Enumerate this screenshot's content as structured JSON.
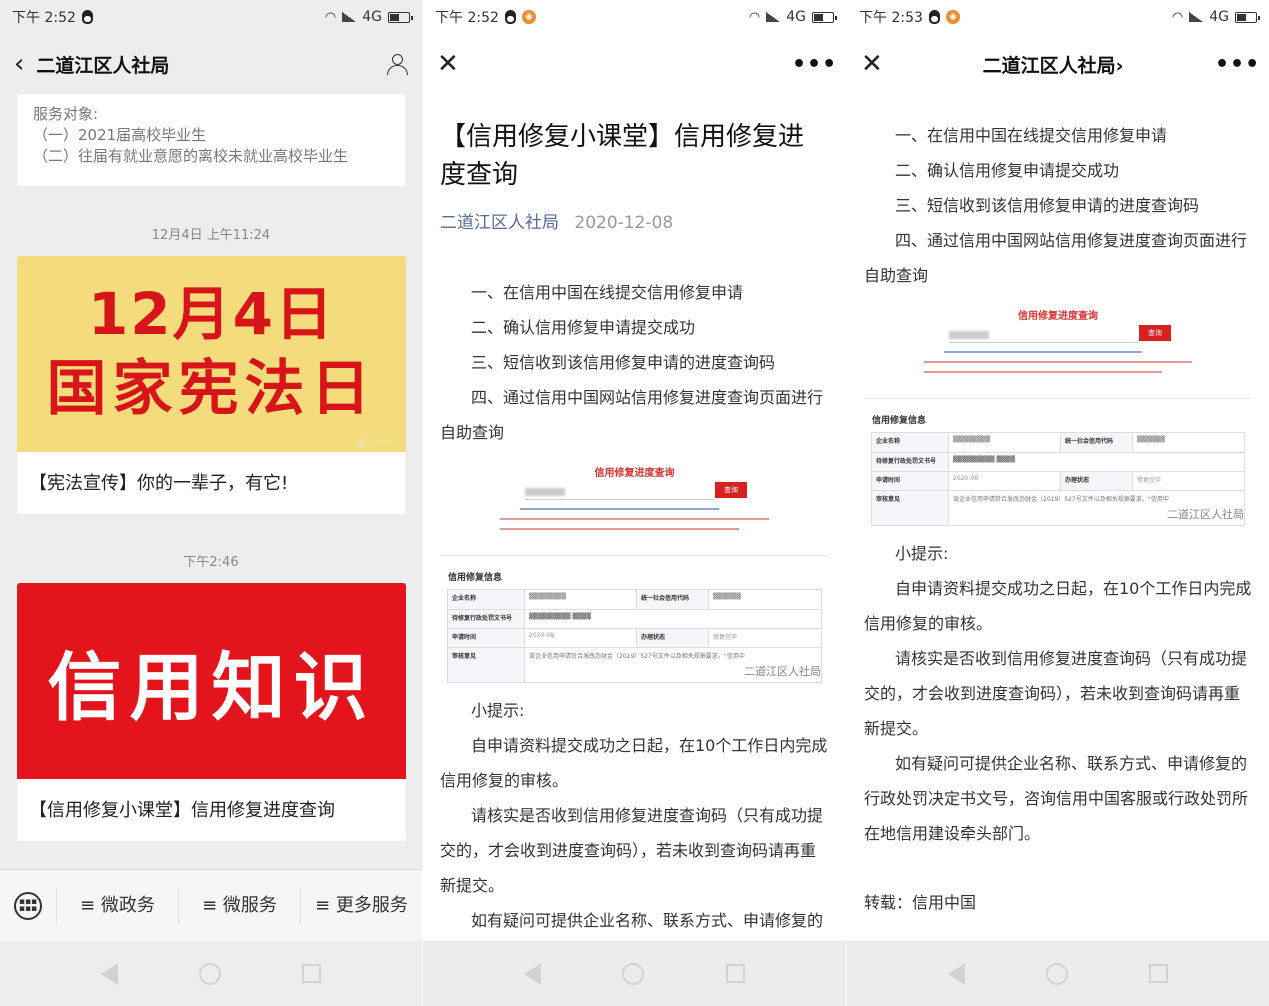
{
  "phone1": {
    "status": {
      "time": "下午 2:52",
      "net": "4G"
    },
    "nav": {
      "title": "二道江区人社局"
    },
    "service": {
      "lines": [
        "服务对象:",
        "（一）2021届高校毕业生",
        "（二）往届有就业意愿的离校未就业高校毕业生"
      ]
    },
    "messages": [
      {
        "time": "12月4日 上午11:24",
        "banner_line1": "12月4日",
        "banner_line2": "国家宪法日",
        "caption": "【宪法宣传】你的一辈子，有它!"
      },
      {
        "time": "下午2:46",
        "banner_line1": "信用知识",
        "caption": "【信用修复小课堂】信用修复进度查询"
      }
    ],
    "menu": [
      {
        "label": "≡ 微政务"
      },
      {
        "label": "≡ 微服务"
      },
      {
        "label": "≡ 更多服务"
      }
    ]
  },
  "phone2": {
    "status": {
      "time": "下午 2:52",
      "net": "4G"
    },
    "article": {
      "title": "【信用修复小课堂】信用修复进度查询",
      "account": "二道江区人社局",
      "date": "2020-12-08",
      "steps": [
        "一、在信用中国在线提交信用修复申请",
        "二、确认信用修复申请提交成功",
        "三、短信收到该信用修复申请的进度查询码",
        "四、通过信用中国网站信用修复进度查询页面进行自助查询"
      ],
      "image": {
        "search_title": "信用修复进度查询",
        "search_btn": "查询",
        "table_caption": "信用修复信息",
        "rows": [
          {
            "k1": "企业名称",
            "k2": "统一社会信用代码"
          },
          {
            "k1": "待修复行政处罚文书号"
          },
          {
            "k1": "申请时间",
            "v1": "2020-08",
            "k2": "办理状态",
            "v2": "修复完毕"
          },
          {
            "k1": "审核意见",
            "v1": "该企业信用申请符合发改办财金（2019）527号文件以及相关规章要求。“信用中"
          }
        ],
        "watermark": "二道江区人社局"
      },
      "tip_title": "小提示:",
      "tips": [
        "自申请资料提交成功之日起，在10个工作日内完成信用修复的审核。",
        "请核实是否收到信用修复进度查询码（只有成功提交的，才会收到进度查询码），若未收到查询码请再重新提交。",
        "如有疑问可提供企业名称、联系方式、申请修复的行"
      ]
    }
  },
  "phone3": {
    "status": {
      "time": "下午 2:53",
      "net": "4G"
    },
    "nav": {
      "title": "二道江区人社局›"
    },
    "article": {
      "steps": [
        "一、在信用中国在线提交信用修复申请",
        "二、确认信用修复申请提交成功",
        "三、短信收到该信用修复申请的进度查询码",
        "四、通过信用中国网站信用修复进度查询页面进行自助查询"
      ],
      "image": {
        "search_title": "信用修复进度查询",
        "search_btn": "查询",
        "table_caption": "信用修复信息",
        "rows": [
          {
            "k1": "企业名称",
            "k2": "统一社会信用代码"
          },
          {
            "k1": "待修复行政处罚文书号"
          },
          {
            "k1": "申请时间",
            "v1": "2020-08",
            "k2": "办理状态",
            "v2": "修复完毕"
          },
          {
            "k1": "审核意见",
            "v1": "该企业信用申请符合发改办财金（2019）527号文件以及相关规章要求。“信用中"
          }
        ],
        "watermark": "二道江区人社局"
      },
      "tip_title": "小提示:",
      "tips": [
        "自申请资料提交成功之日起，在10个工作日内完成信用修复的审核。",
        "请核实是否收到信用修复进度查询码（只有成功提交的，才会收到进度查询码），若未收到查询码请再重新提交。",
        "如有疑问可提供企业名称、联系方式、申请修复的行政处罚决定书文号，咨询信用中国客服或行政处罚所在地信用建设牵头部门。"
      ],
      "source": "转载：信用中国"
    }
  },
  "colors": {
    "accent_red": "#e3141b",
    "banner_yellow": "#f4dc7c",
    "link_blue": "#576b95"
  }
}
